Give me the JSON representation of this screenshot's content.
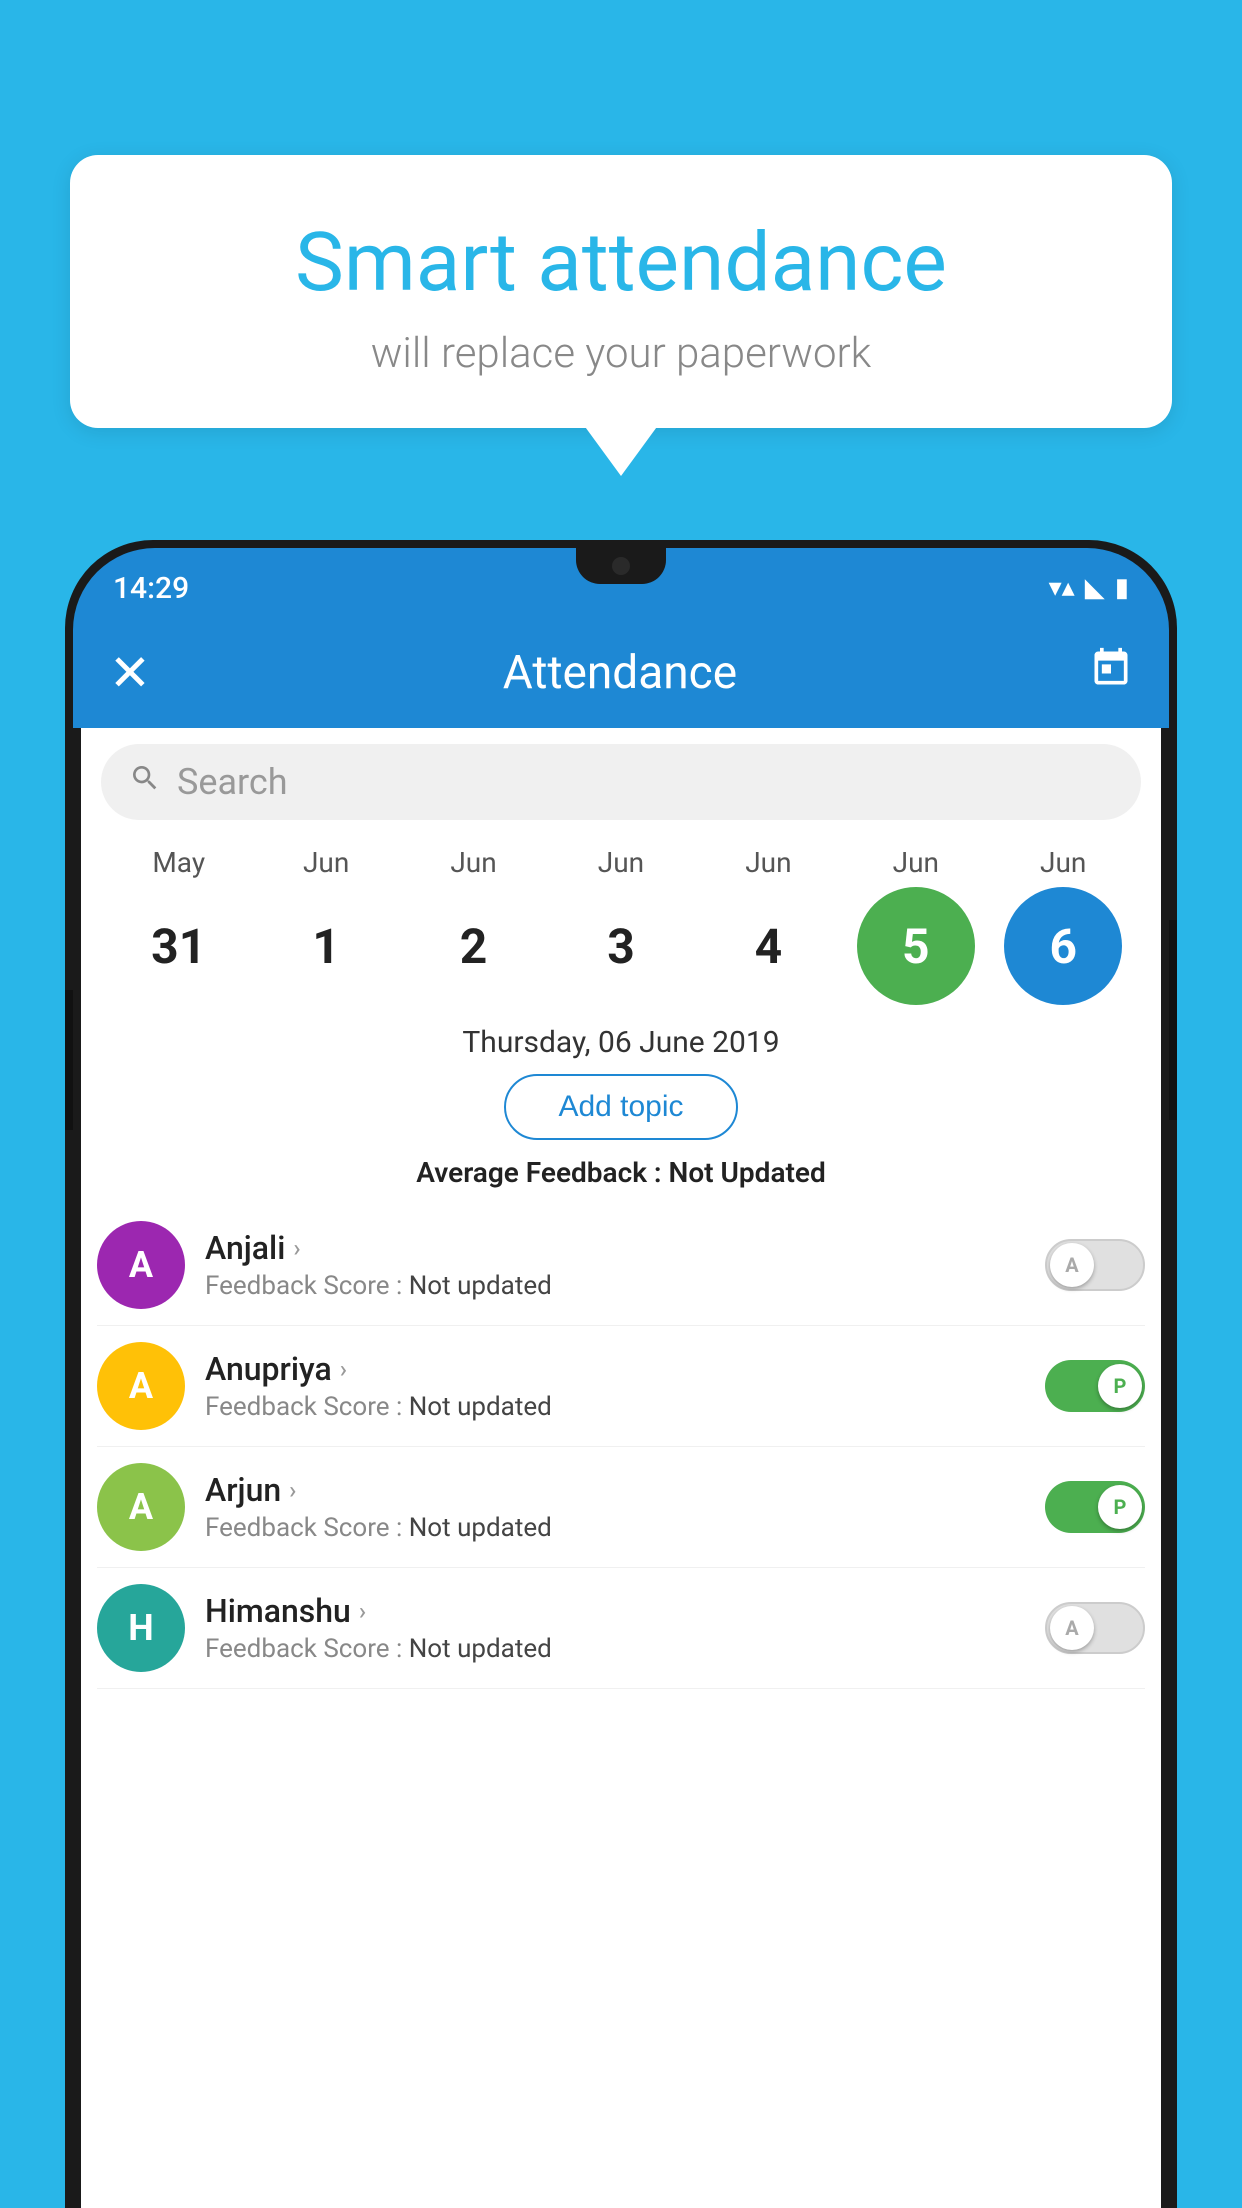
{
  "background_color": "#29b6e8",
  "speech_bubble": {
    "title": "Smart attendance",
    "subtitle": "will replace your paperwork"
  },
  "status_bar": {
    "time": "14:29",
    "wifi_icon": "▼",
    "signal_icon": "▲",
    "battery_icon": "▮"
  },
  "app_bar": {
    "close_icon": "✕",
    "title": "Attendance",
    "calendar_icon": "📅"
  },
  "search": {
    "placeholder": "Search"
  },
  "calendar": {
    "months": [
      "May",
      "Jun",
      "Jun",
      "Jun",
      "Jun",
      "Jun",
      "Jun"
    ],
    "dates": [
      "31",
      "1",
      "2",
      "3",
      "4",
      "5",
      "6"
    ],
    "selected_green_index": 5,
    "selected_blue_index": 6
  },
  "selected_date": "Thursday, 06 June 2019",
  "add_topic_label": "Add topic",
  "avg_feedback_label": "Average Feedback :",
  "avg_feedback_value": "Not Updated",
  "students": [
    {
      "name": "Anjali",
      "avatar_letter": "A",
      "avatar_color": "purple",
      "feedback_label": "Feedback Score :",
      "feedback_value": "Not updated",
      "toggle_state": "off",
      "toggle_label": "A"
    },
    {
      "name": "Anupriya",
      "avatar_letter": "A",
      "avatar_color": "yellow",
      "feedback_label": "Feedback Score :",
      "feedback_value": "Not updated",
      "toggle_state": "on",
      "toggle_label": "P"
    },
    {
      "name": "Arjun",
      "avatar_letter": "A",
      "avatar_color": "green",
      "feedback_label": "Feedback Score :",
      "feedback_value": "Not updated",
      "toggle_state": "on",
      "toggle_label": "P"
    },
    {
      "name": "Himanshu",
      "avatar_letter": "H",
      "avatar_color": "teal",
      "feedback_label": "Feedback Score :",
      "feedback_value": "Not updated",
      "toggle_state": "off",
      "toggle_label": "A"
    }
  ]
}
